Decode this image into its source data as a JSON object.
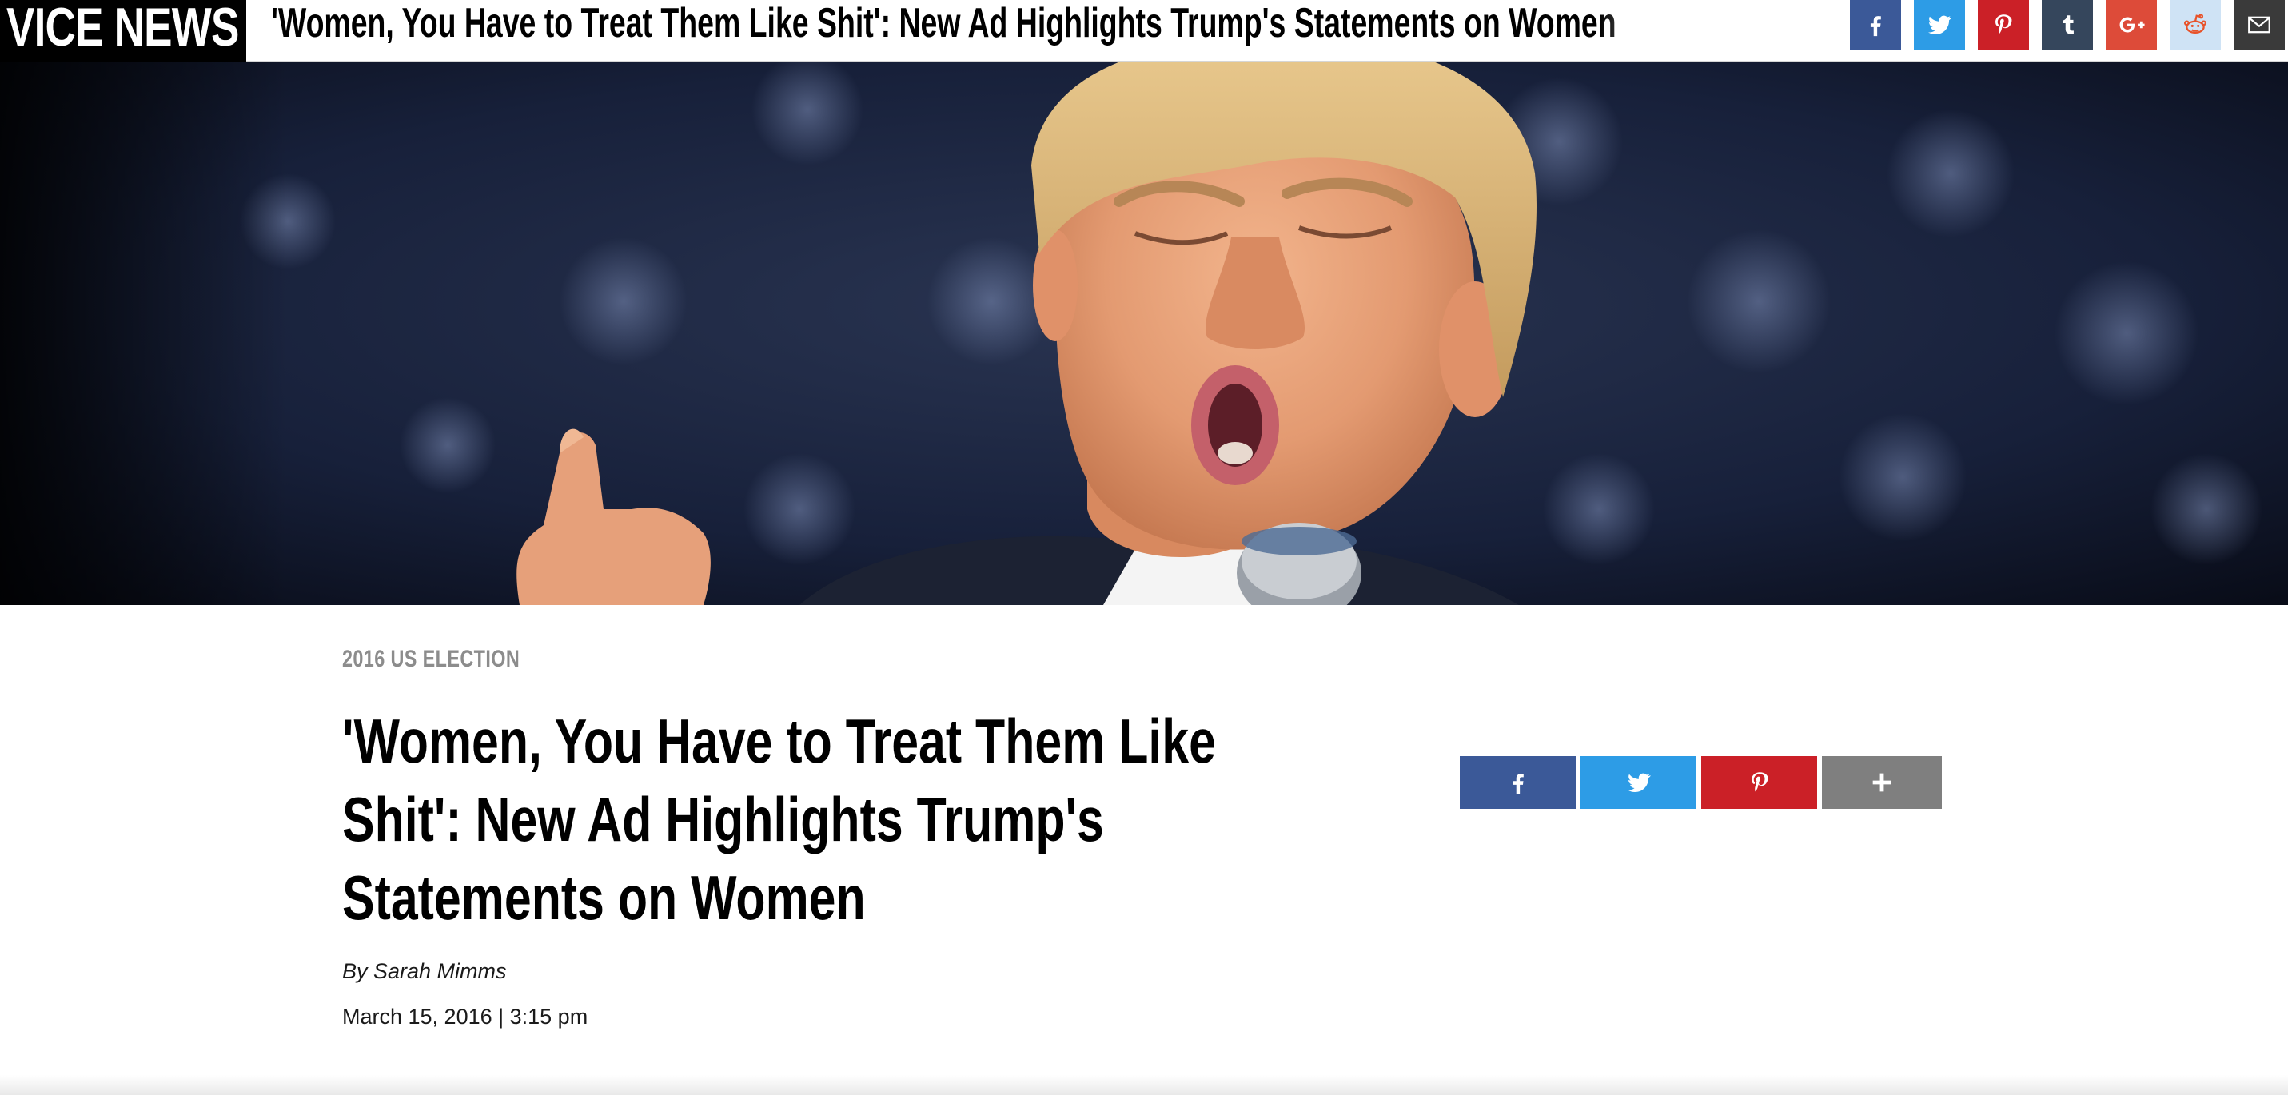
{
  "site": {
    "logo_text": "VICE NEWS"
  },
  "topbar": {
    "headline": "'Women, You Have to Treat Them Like Shit': New Ad Highlights Trump's Statements on Women",
    "share_icons": [
      "facebook-icon",
      "twitter-icon",
      "pinterest-icon",
      "tumblr-icon",
      "google-plus-icon",
      "reddit-icon",
      "mail-icon"
    ]
  },
  "article": {
    "category": "2016 US ELECTION",
    "title": "'Women, You Have to Treat Them Like Shit': New Ad Highlights Trump's Statements on Women",
    "byline": "By Sarah Mimms",
    "date": "March 15, 2016 | 3:15 pm",
    "share_icons": [
      "facebook-icon",
      "twitter-icon",
      "pinterest-icon",
      "plus-icon"
    ]
  },
  "colors": {
    "facebook": "#3b5998",
    "twitter": "#2d9ce6",
    "pinterest": "#cb2027",
    "tumblr": "#35465c",
    "google_plus": "#dd4b39",
    "reddit_bg": "#cfe3f5",
    "mail": "#3a3a3a",
    "more": "#7f7f7f",
    "category_gray": "#8c8c8c"
  }
}
